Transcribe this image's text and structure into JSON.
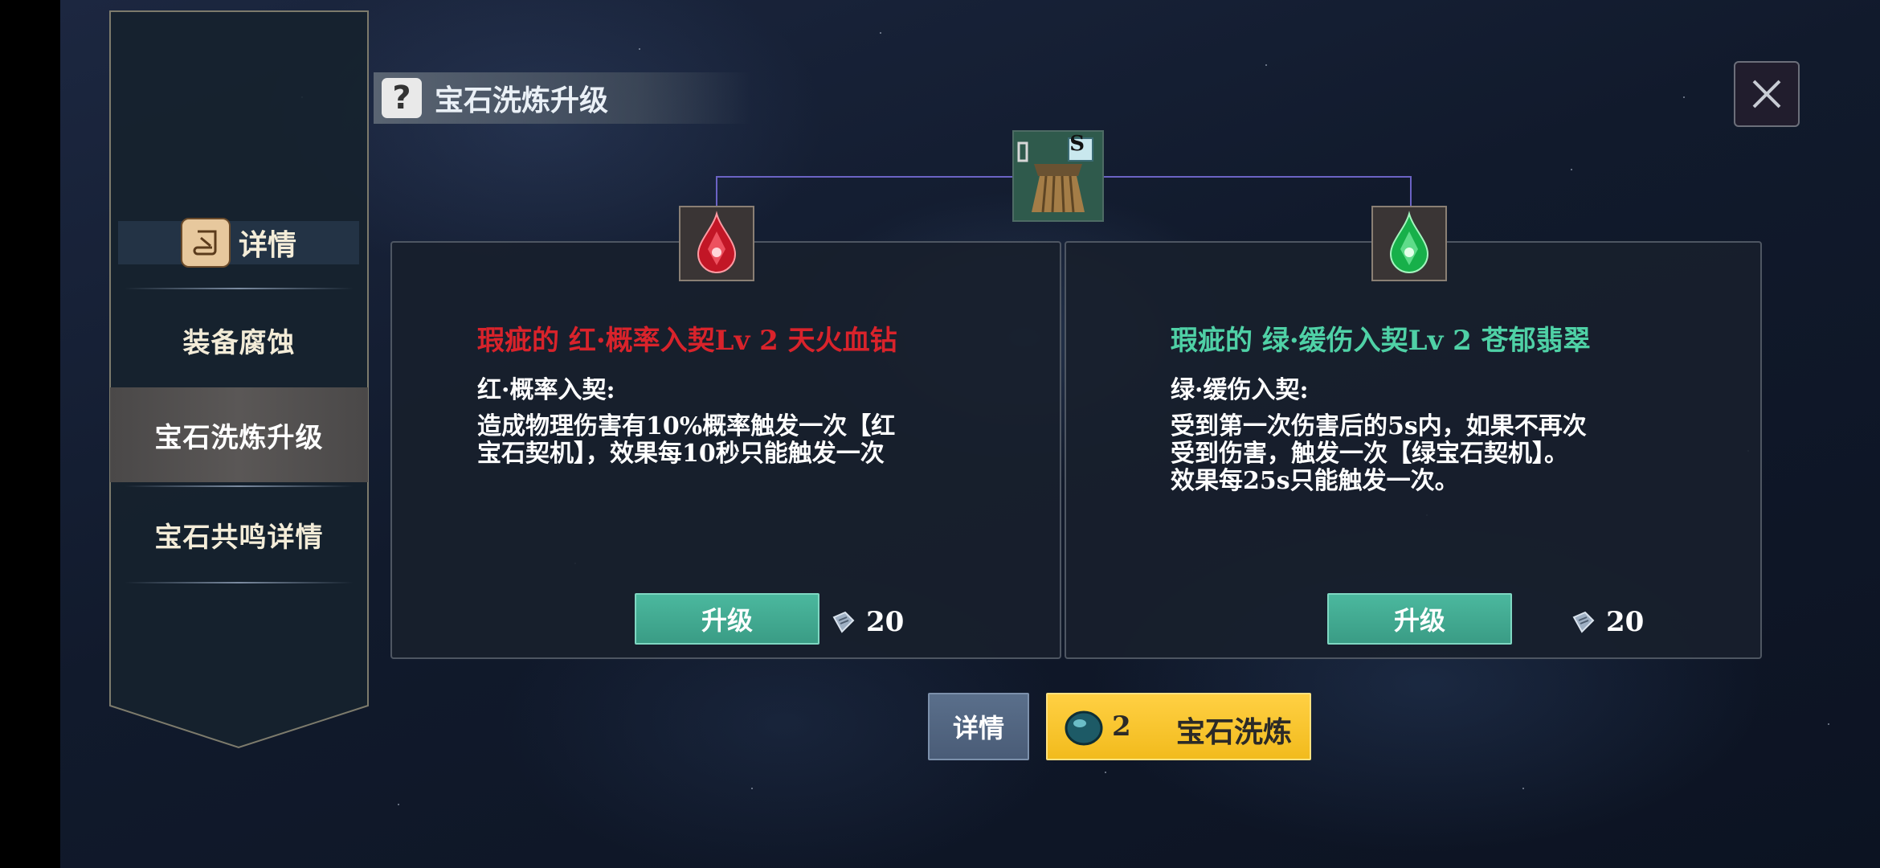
{
  "window": {
    "title": "宝石洗炼升级"
  },
  "sidebar": {
    "items": [
      {
        "label": "详情",
        "icon": "scroll-icon",
        "active": false
      },
      {
        "label": "装备腐蚀",
        "active": false
      },
      {
        "label": "宝石洗炼升级",
        "active": true
      },
      {
        "label": "宝石共鸣详情",
        "active": false
      }
    ]
  },
  "equipment": {
    "grade": "S",
    "icon": "equipment-tassel-icon"
  },
  "cards": [
    {
      "gem_color": "red",
      "gem_title": "瑕疵的 红·概率入契Lv 2 天火血钻",
      "effect_name": "红·概率入契:",
      "description": "造成物理伤害有10%概率触发一次【红\n宝石契机】，效果每10秒只能触发一次",
      "upgrade_label": "升级",
      "cost": "20",
      "title_color": "#d9232b"
    },
    {
      "gem_color": "green",
      "gem_title": "瑕疵的 绿·缓伤入契Lv 2 苍郁翡翠",
      "effect_name": "绿·缓伤入契:",
      "description": "受到第一次伤害后的5s内，如果不再次\n受到伤害，触发一次【绿宝石契机】。\n效果每25s只能触发一次。",
      "upgrade_label": "升级",
      "cost": "20",
      "title_color": "#4fd1a6"
    }
  ],
  "bottom": {
    "detail_label": "详情",
    "refine_count": "2",
    "refine_label": "宝石洗炼"
  },
  "colors": {
    "accent_teal": "#3a9c85",
    "accent_yellow": "#f2bb1d",
    "panel_bg": "#18202c"
  }
}
